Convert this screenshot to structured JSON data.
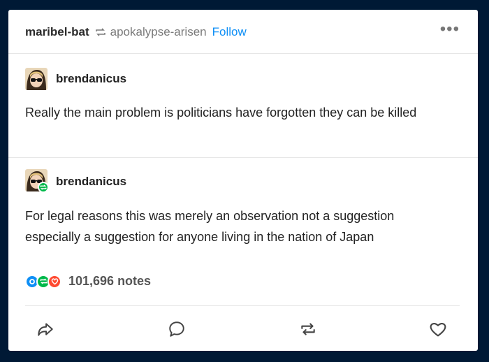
{
  "header": {
    "author": "maribel-bat",
    "reblogged_from": "apokalypse-arisen",
    "follow_label": "Follow",
    "more_label": "•••"
  },
  "posts": [
    {
      "username": "brendanicus",
      "text": "Really the main problem is politicians have forgotten they can be killed"
    },
    {
      "username": "brendanicus",
      "text": "For legal reasons this was merely an observation not a suggestion especially a suggestion for anyone living in the nation of Japan"
    }
  ],
  "notes": {
    "count": "101,696 notes"
  },
  "colors": {
    "accent": "#0f8ff5",
    "background": "#001935",
    "reply_blue": "#0f8ff5",
    "reblog_green": "#00b84a",
    "like_red": "#ff4930"
  },
  "icons": [
    "reblog-icon",
    "more-options-icon",
    "share-icon",
    "reply-icon",
    "reblog-action-icon",
    "like-icon"
  ]
}
